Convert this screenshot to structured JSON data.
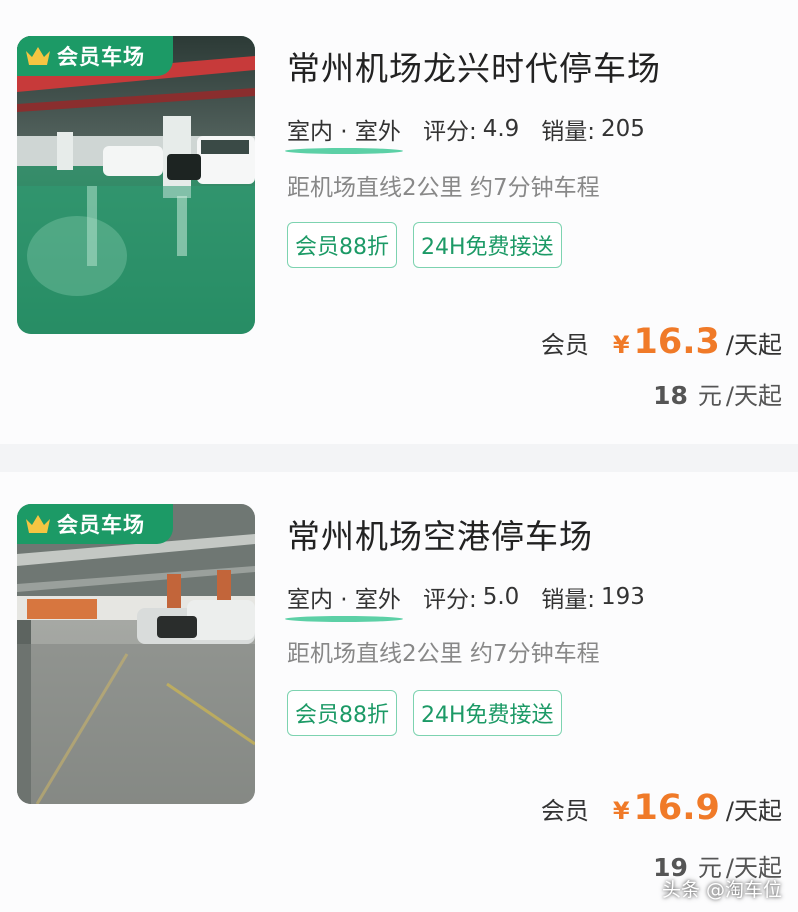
{
  "listings": [
    {
      "badge": "会员车场",
      "title": "常州机场龙兴时代停车场",
      "type": "室内 · 室外",
      "rating_label": "评分:",
      "rating": "4.9",
      "sales_label": "销量:",
      "sales": "205",
      "distance": "距机场直线2公里 约7分钟车程",
      "tags": [
        "会员88折",
        "24H免费接送"
      ],
      "member_label": "会员",
      "currency": "¥",
      "member_price": "16.3",
      "per_day": "/天起",
      "original_price": "18",
      "original_unit": "元"
    },
    {
      "badge": "会员车场",
      "title": "常州机场空港停车场",
      "type": "室内 · 室外",
      "rating_label": "评分:",
      "rating": "5.0",
      "sales_label": "销量:",
      "sales": "193",
      "distance": "距机场直线2公里 约7分钟车程",
      "tags": [
        "会员88折",
        "24H免费接送"
      ],
      "member_label": "会员",
      "currency": "¥",
      "member_price": "16.9",
      "per_day": "/天起",
      "original_price": "19",
      "original_unit": "元"
    }
  ],
  "watermark": "头条 @淘车位",
  "colors": {
    "brand_green": "#1c9a66",
    "price_orange": "#f07a28",
    "tag_border": "#7dd3b0"
  }
}
